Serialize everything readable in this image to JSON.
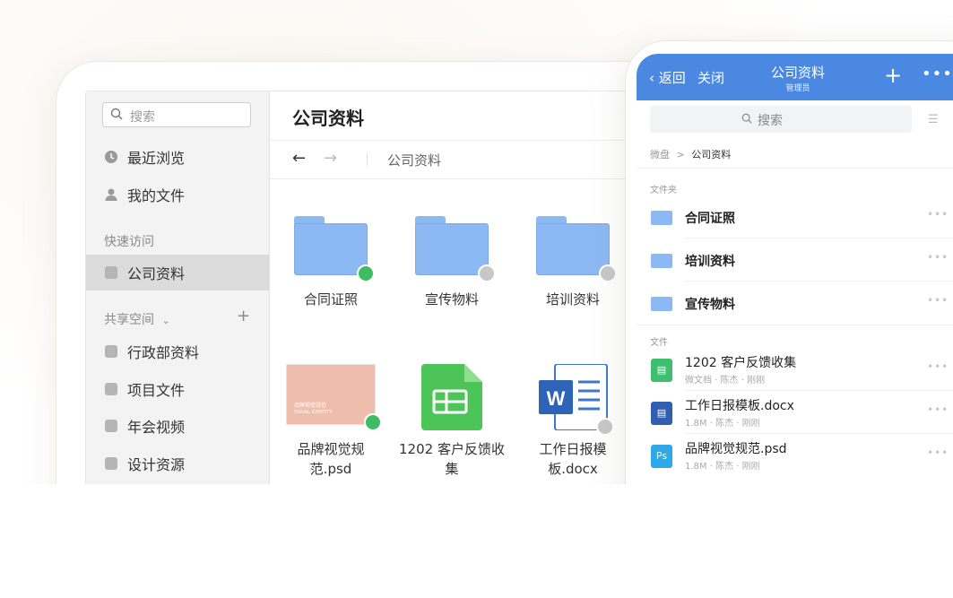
{
  "desktop": {
    "search_placeholder": "搜索",
    "nav": [
      {
        "label": "最近浏览",
        "icon": "clock-icon"
      },
      {
        "label": "我的文件",
        "icon": "user-icon"
      }
    ],
    "quick_access_label": "快速访问",
    "quick_access": [
      {
        "label": "公司资料",
        "icon": "cube-icon"
      }
    ],
    "shared_label": "共享空间",
    "shared_add": "+",
    "shared": [
      {
        "label": "行政部资料"
      },
      {
        "label": "项目文件"
      },
      {
        "label": "年会视频"
      },
      {
        "label": "设计资源"
      }
    ],
    "title": "公司资料",
    "back_arrow": "←",
    "forward_arrow": "→",
    "breadcrumb": "公司资料",
    "folders": [
      {
        "label": "合同证照",
        "status": "synced"
      },
      {
        "label": "宣传物料",
        "status": "cloud"
      },
      {
        "label": "培训资料",
        "status": "cloud"
      }
    ],
    "files": [
      {
        "label": "品牌视觉规范.psd",
        "thumb_title": "品牌视觉规范",
        "thumb_sub": "VISUAL IDENTITY",
        "status": "synced"
      },
      {
        "label": "1202 客户反馈收集",
        "status": ""
      },
      {
        "label": "工作日报模板.docx",
        "status": "cloud"
      }
    ]
  },
  "phone": {
    "back": "返回",
    "close": "关闭",
    "title": "公司资料",
    "subtitle": "管理员",
    "plus": "+",
    "more": "•••",
    "search_placeholder": "搜索",
    "crumb_root": "微盘",
    "crumb_sep": ">",
    "crumb_current": "公司资料",
    "folder_section": "文件夹",
    "folders": [
      {
        "name": "合同证照"
      },
      {
        "name": "培训资料"
      },
      {
        "name": "宣传物料"
      }
    ],
    "file_section": "文件",
    "files": [
      {
        "name": "1202 客户反馈收集",
        "meta": "微文档 · 陈杰 · 刚刚",
        "icon": "sheet-icon",
        "icon_text": "",
        "color": "#3ebf6f"
      },
      {
        "name": "工作日报模板.docx",
        "meta": "1.8M · 陈杰 · 刚刚",
        "icon": "doc-icon",
        "icon_text": "",
        "color": "#2f5fae"
      },
      {
        "name": "品牌视觉规范.psd",
        "meta": "1.8M · 陈杰 · 刚刚",
        "icon": "ps-icon",
        "icon_text": "Ps",
        "color": "#2ea8e6"
      }
    ],
    "row_more": "•••"
  },
  "colors": {
    "accent": "#4a88e1",
    "folder": "#8cb8f3",
    "synced": "#3ebc62"
  }
}
